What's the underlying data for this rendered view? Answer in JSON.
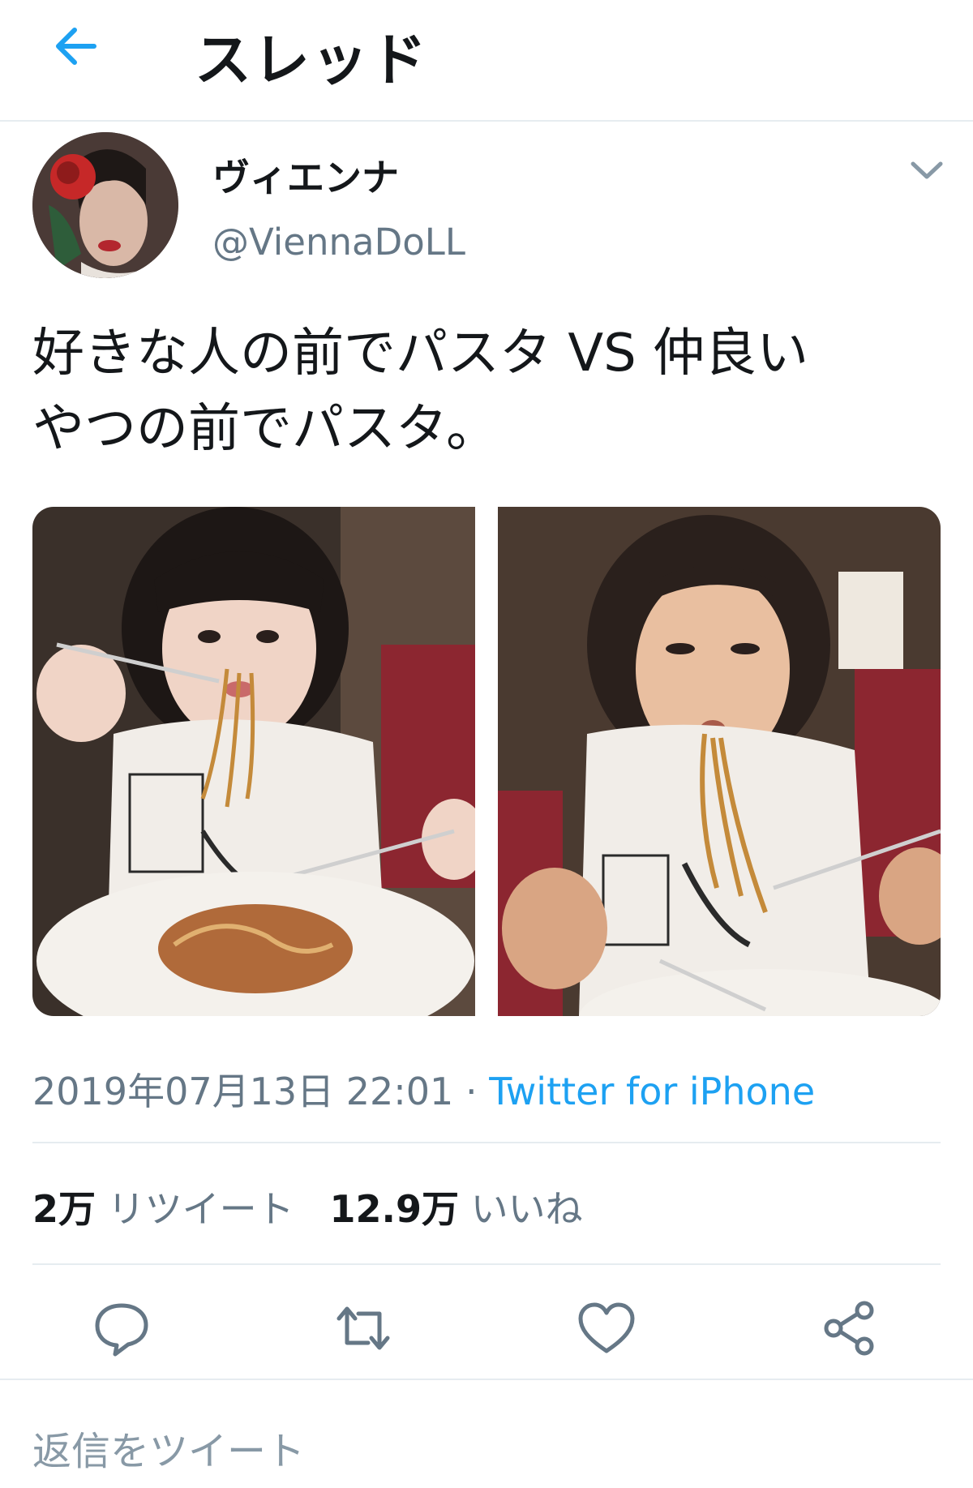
{
  "header": {
    "title": "スレッド"
  },
  "tweet": {
    "display_name": "ヴィエンナ",
    "handle": "@ViennaDoLL",
    "text_line1": "好きな人の前でパスタ VS 仲良い",
    "text_line2": "やつの前でパスタ。",
    "timestamp": "2019年07月13日 22:01",
    "separator": "·",
    "source": "Twitter for iPhone",
    "retweets_count": "2万",
    "retweets_label": "リツイート",
    "likes_count": "12.9万",
    "likes_label": "いいね"
  },
  "reply": {
    "placeholder": "返信をツイート"
  },
  "icons": {
    "back": "arrow-left-icon",
    "caret": "chevron-down-icon",
    "reply": "speech-bubble-icon",
    "retweet": "retweet-icon",
    "like": "heart-icon",
    "share": "share-icon"
  },
  "colors": {
    "accent": "#1da1f2",
    "text": "#14171a",
    "secondary": "#657786",
    "divider": "#e6ecf0"
  }
}
